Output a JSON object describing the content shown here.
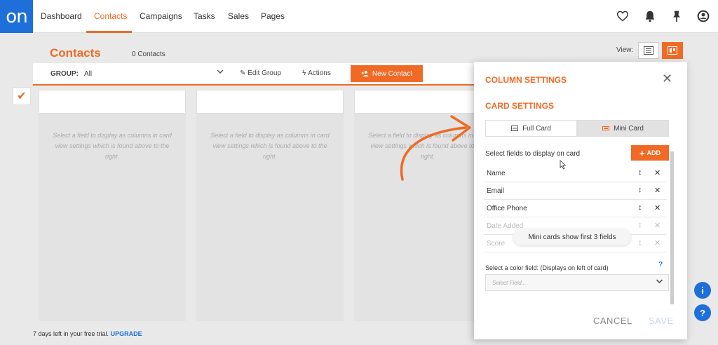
{
  "logo": "on",
  "nav": {
    "items": [
      {
        "label": "Dashboard"
      },
      {
        "label": "Contacts"
      },
      {
        "label": "Campaigns"
      },
      {
        "label": "Tasks"
      },
      {
        "label": "Sales"
      },
      {
        "label": "Pages"
      }
    ],
    "active": "Contacts",
    "icons": [
      "heart-icon",
      "bell-icon",
      "pin-icon",
      "user-icon"
    ]
  },
  "header": {
    "title": "Contacts",
    "count": "0 Contacts",
    "view_label": "View:"
  },
  "toolbar": {
    "group_label": "GROUP:",
    "group_value": "All",
    "edit_group": "Edit Group",
    "actions": "Actions",
    "new_contact": "New Contact"
  },
  "columns": {
    "hint": "Select a field to display as columns in card view settings which is found above to the right."
  },
  "trial": {
    "text": "7 days left in your free trial.",
    "upgrade": "UPGRADE"
  },
  "panel": {
    "title": "COLUMN SETTINGS",
    "card_settings": "CARD SETTINGS",
    "full_card": "Full Card",
    "mini_card": "Mini Card",
    "select_fields": "Select fields to display on card",
    "add": "ADD",
    "fields": [
      "Name",
      "Email",
      "Office Phone",
      "Date Added",
      "Score"
    ],
    "tooltip": "Mini cards show first 3 fields",
    "color_field_label": "Select a color field: (Displays on left of card)",
    "help": "?",
    "color_placeholder": "Select Field...",
    "cancel": "CANCEL",
    "save": "SAVE"
  },
  "colors": {
    "accent": "#f06a25",
    "brand": "#1e6fd9"
  }
}
